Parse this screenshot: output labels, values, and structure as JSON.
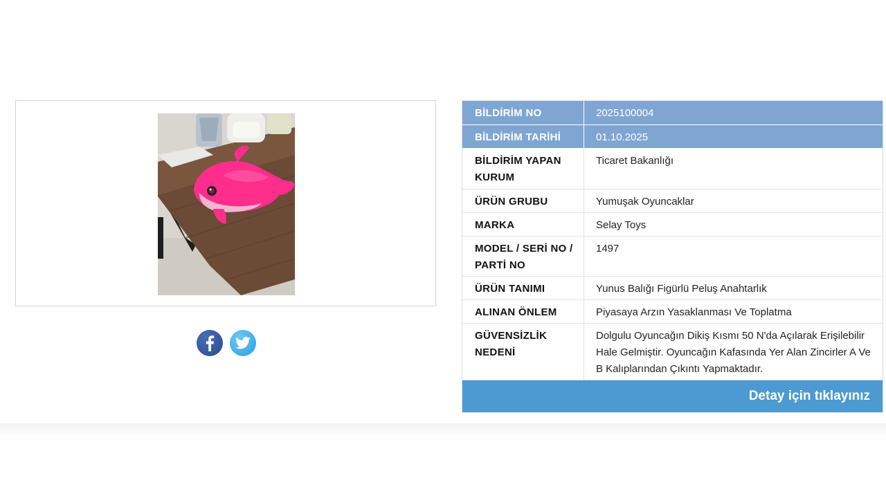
{
  "notice": {
    "rows": [
      {
        "label": "BİLDİRİM NO",
        "value": "2025100004"
      },
      {
        "label": "BİLDİRİM TARİHİ",
        "value": "01.10.2025"
      },
      {
        "label": "BİLDİRİM YAPAN KURUM",
        "value": "Ticaret Bakanlığı"
      },
      {
        "label": "ÜRÜN GRUBU",
        "value": "Yumuşak Oyuncaklar"
      },
      {
        "label": "MARKA",
        "value": "Selay Toys"
      },
      {
        "label": "MODEL / SERİ NO / PARTİ NO",
        "value": "1497"
      },
      {
        "label": "ÜRÜN TANIMI",
        "value": "Yunus Balığı Figürlü Peluş Anahtarlık"
      },
      {
        "label": "ALINAN ÖNLEM",
        "value": "Piyasaya Arzın Yasaklanması Ve Toplatma"
      },
      {
        "label": "GÜVENSİZLİK NEDENİ",
        "value": "Dolgulu Oyuncağın Dikiş Kısmı 50 N'da Açılarak Erişilebilir Hale Gelmiştir. Oyuncağın Kafasında Yer Alan Zincirler A Ve B Kalıplarından Çıkıntı Yapmaktadır."
      }
    ],
    "detail_label": "Detay için tıklayınız"
  },
  "social": {
    "facebook_icon": "facebook-icon",
    "twitter_icon": "twitter-icon"
  },
  "colors": {
    "header_row": "#7fa6d2",
    "detail_button": "#4d9ad2",
    "facebook": "#2f4f95",
    "twitter": "#3aa5e6"
  }
}
